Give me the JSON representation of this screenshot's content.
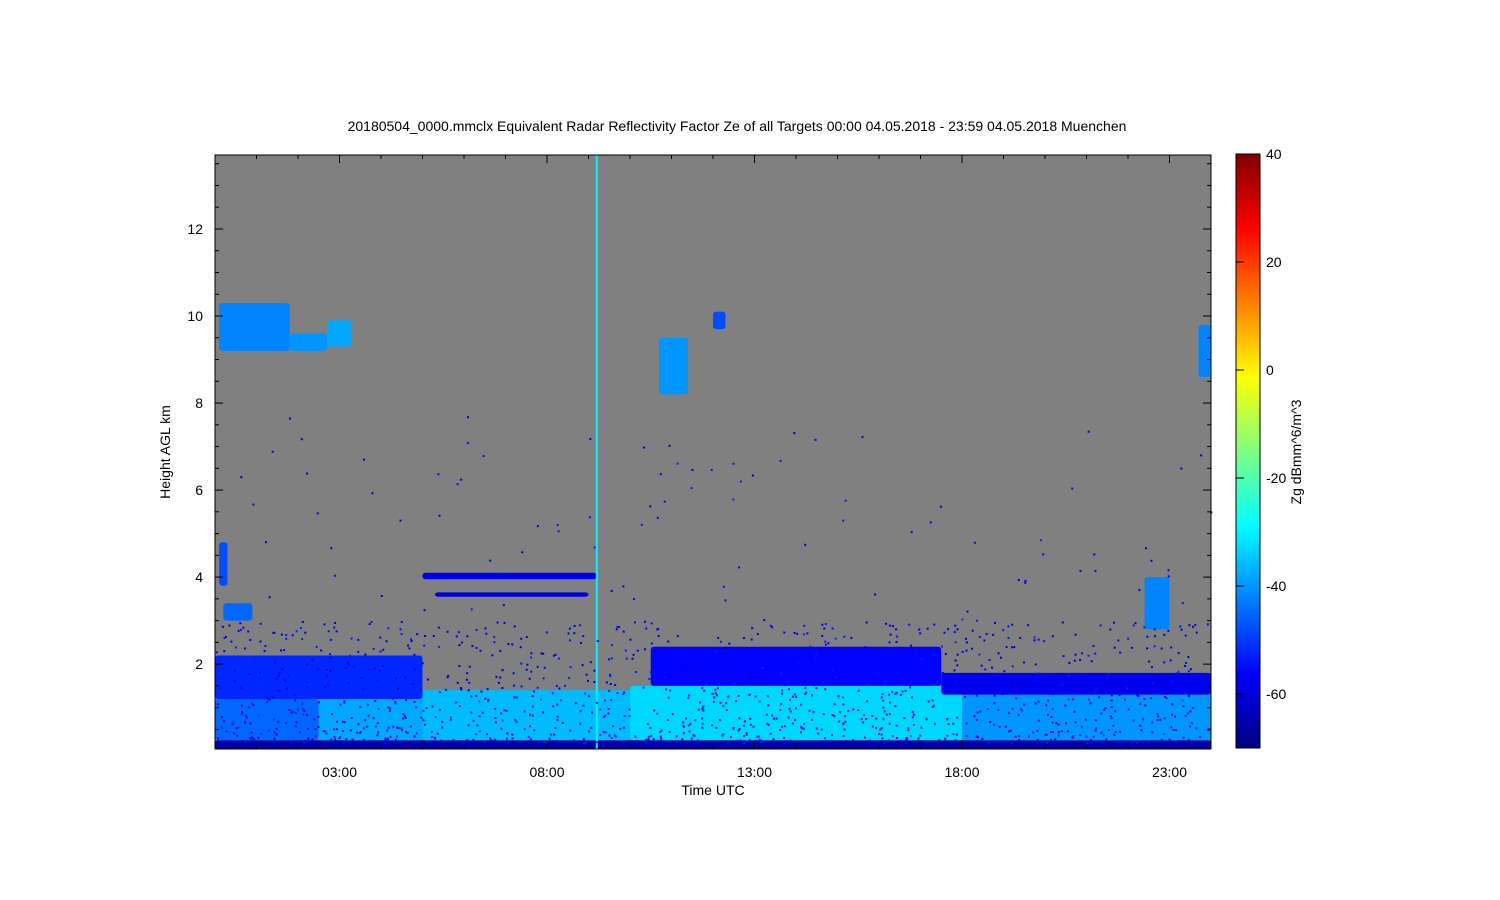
{
  "chart_data": {
    "type": "heatmap",
    "title": "20180504_0000.mmclx Equivalent Radar Reflectivity Factor Ze of all Targets   00:00 04.05.2018 - 23:59 04.05.2018 Muenchen",
    "xlabel": "Time UTC",
    "ylabel": "Height AGL km",
    "colorbar_label": "Zg dBmm^6/m^3",
    "x_unit": "hours UTC",
    "xlim": [
      0,
      24
    ],
    "ylim": [
      0.05,
      13.7
    ],
    "clim": [
      -70,
      40
    ],
    "x_ticks": [
      {
        "value": 3,
        "label": "03:00"
      },
      {
        "value": 8,
        "label": "08:00"
      },
      {
        "value": 13,
        "label": "13:00"
      },
      {
        "value": 18,
        "label": "18:00"
      },
      {
        "value": 23,
        "label": "23:00"
      }
    ],
    "y_ticks": [
      {
        "value": 2,
        "label": "2"
      },
      {
        "value": 4,
        "label": "4"
      },
      {
        "value": 6,
        "label": "6"
      },
      {
        "value": 8,
        "label": "8"
      },
      {
        "value": 10,
        "label": "10"
      },
      {
        "value": 12,
        "label": "12"
      }
    ],
    "colorbar_ticks": [
      {
        "value": 40,
        "label": "40"
      },
      {
        "value": 20,
        "label": "20"
      },
      {
        "value": 0,
        "label": "0"
      },
      {
        "value": -20,
        "label": "-20"
      },
      {
        "value": -40,
        "label": "-40"
      },
      {
        "value": -60,
        "label": "-60"
      }
    ],
    "colormap": [
      "#00007f",
      "#0000ff",
      "#007fff",
      "#00ffff",
      "#7fff7f",
      "#ffff00",
      "#ff7f00",
      "#ff0000",
      "#7f0000"
    ],
    "background_color": "#808080",
    "features": [
      {
        "t0": 0,
        "t1": 24,
        "h0": 0.05,
        "h1": 0.25,
        "ze": -66
      },
      {
        "t0": 0,
        "t1": 2.5,
        "h0": 0.25,
        "h1": 1.2,
        "ze": -45
      },
      {
        "t0": 2.5,
        "t1": 5,
        "h0": 0.25,
        "h1": 1.5,
        "ze": -38
      },
      {
        "t0": 5,
        "t1": 10,
        "h0": 0.25,
        "h1": 1.4,
        "ze": -36
      },
      {
        "t0": 10,
        "t1": 18,
        "h0": 0.25,
        "h1": 1.5,
        "ze": -33
      },
      {
        "t0": 18,
        "t1": 24,
        "h0": 0.25,
        "h1": 1.3,
        "ze": -40
      },
      {
        "t0": 0,
        "t1": 5,
        "h0": 1.2,
        "h1": 2.2,
        "ze": -52
      },
      {
        "t0": 10.5,
        "t1": 17.5,
        "h0": 1.5,
        "h1": 2.4,
        "ze": -56
      },
      {
        "t0": 17.5,
        "t1": 24,
        "h0": 1.3,
        "h1": 1.8,
        "ze": -58
      },
      {
        "t0": 0.1,
        "t1": 1.8,
        "h0": 9.2,
        "h1": 10.3,
        "ze": -42
      },
      {
        "t0": 1.8,
        "t1": 2.7,
        "h0": 9.2,
        "h1": 9.6,
        "ze": -40
      },
      {
        "t0": 2.7,
        "t1": 3.3,
        "h0": 9.3,
        "h1": 9.9,
        "ze": -38
      },
      {
        "t0": 10.7,
        "t1": 11.4,
        "h0": 8.2,
        "h1": 9.5,
        "ze": -40
      },
      {
        "t0": 12.0,
        "t1": 12.3,
        "h0": 9.7,
        "h1": 10.1,
        "ze": -48
      },
      {
        "t0": 23.7,
        "t1": 24,
        "h0": 8.6,
        "h1": 9.8,
        "ze": -42
      },
      {
        "t0": 0.1,
        "t1": 0.3,
        "h0": 3.8,
        "h1": 4.8,
        "ze": -48
      },
      {
        "t0": 0.2,
        "t1": 0.9,
        "h0": 3.0,
        "h1": 3.4,
        "ze": -45
      },
      {
        "t0": 22.4,
        "t1": 23.0,
        "h0": 2.8,
        "h1": 4.0,
        "ze": -42
      },
      {
        "t0": 5.0,
        "t1": 9.2,
        "h0": 3.95,
        "h1": 4.1,
        "ze": -58
      },
      {
        "t0": 5.3,
        "t1": 9.0,
        "h0": 3.55,
        "h1": 3.65,
        "ze": -60
      }
    ],
    "spike": {
      "t": 9.2,
      "h0": 0.05,
      "h1": 13.7,
      "ze": -30
    }
  }
}
